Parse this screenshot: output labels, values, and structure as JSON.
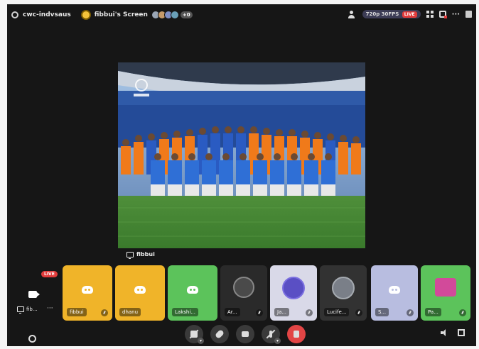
{
  "topbar": {
    "channel": "cwc-indvsaus",
    "screen_title": "fibbui's Screen",
    "participant_extra": "+0",
    "quality": "720p 30FPS",
    "live_badge": "LIVE"
  },
  "stage": {
    "owner_label": "fibbui"
  },
  "sidebar": {
    "live_tag": "LIVE",
    "user_label": "fib...",
    "more": "···"
  },
  "tiles": [
    {
      "label": "fibbui",
      "bg": "#f0b429"
    },
    {
      "label": "dhanu",
      "bg": "#f0b429"
    },
    {
      "label": "Lakshi...",
      "bg": "#5cc35b"
    },
    {
      "label": "Ar...",
      "bg": "#2a2a2a"
    },
    {
      "label": "Ja...",
      "bg": "#d9d9e8"
    },
    {
      "label": "Lucife...",
      "bg": "#323232"
    },
    {
      "label": "S...",
      "bg": "#b8bde0"
    },
    {
      "label": "Pa...",
      "bg": "#5cc35b"
    }
  ],
  "colors": {
    "accent_red": "#e23b3b",
    "discord_yellow": "#f0b429",
    "discord_green": "#5cc35b"
  }
}
